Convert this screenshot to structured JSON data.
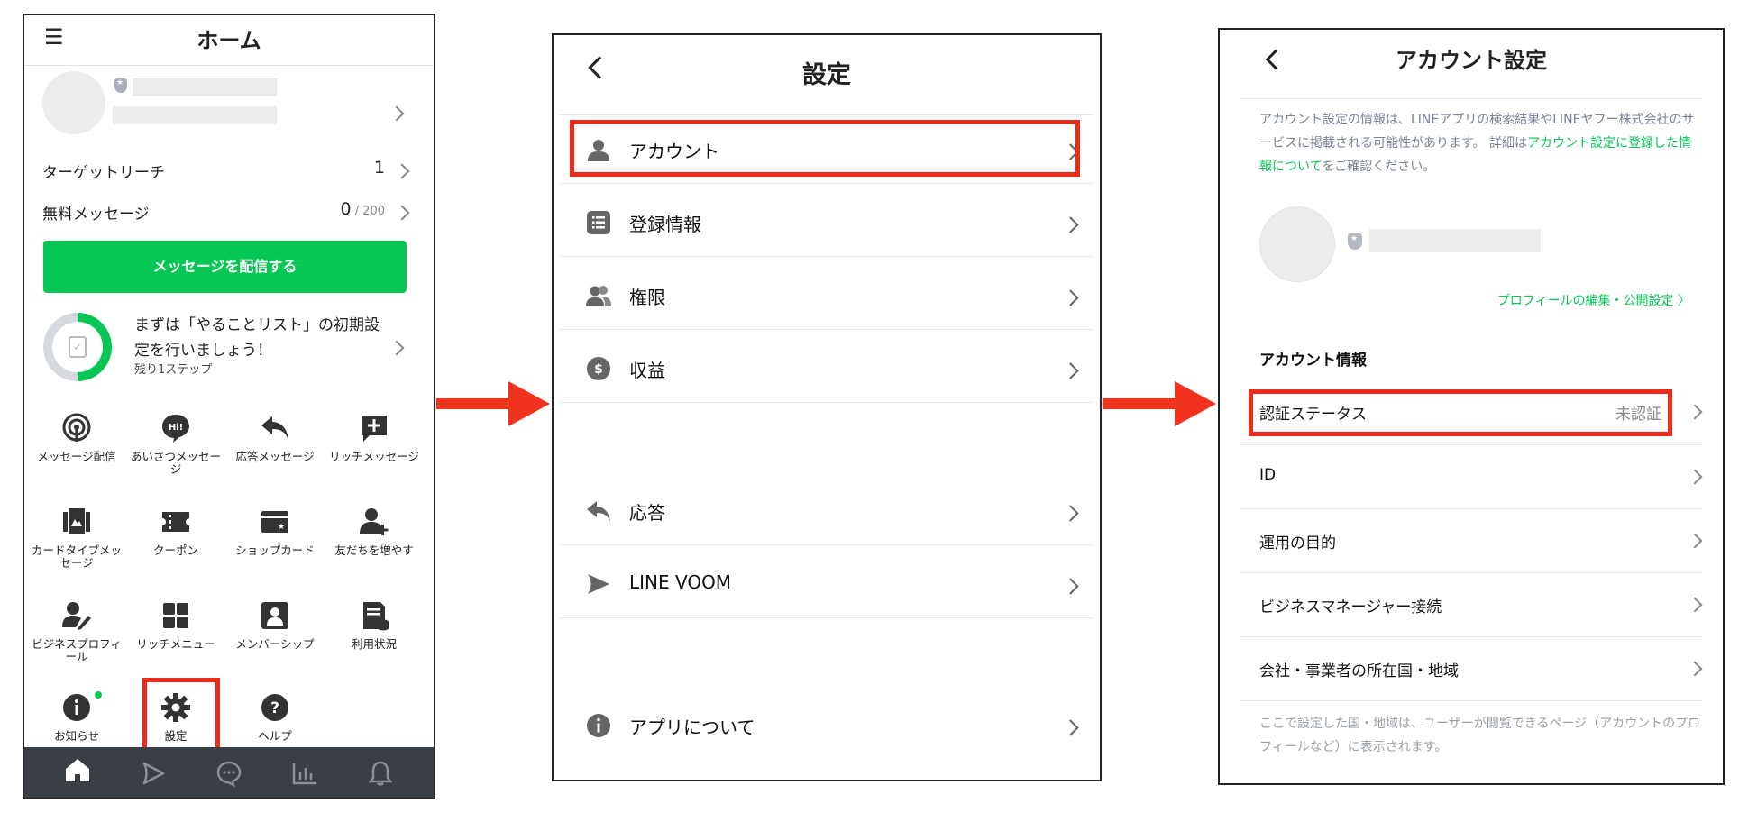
{
  "home": {
    "menu_icon": "hamburger-icon",
    "title": "ホーム",
    "target_reach_label": "ターゲットリーチ",
    "target_reach_value": "1",
    "free_message_label": "無料メッセージ",
    "free_message_value": "0",
    "free_message_total": " / 200",
    "cta_label": "メッセージを配信する",
    "todo_title": "まずは「やることリスト」の初期設定を行いましょう！",
    "todo_sub": "残り1ステップ",
    "todo_progress": 0.5,
    "grid": [
      {
        "label": "メッセージ配信",
        "icon": "broadcast-icon"
      },
      {
        "label": "あいさつメッセージ",
        "icon": "greeting-icon"
      },
      {
        "label": "応答メッセージ",
        "icon": "reply-icon"
      },
      {
        "label": "リッチメッセージ",
        "icon": "rich-message-icon"
      },
      {
        "label": "カードタイプメッセージ",
        "icon": "card-type-icon"
      },
      {
        "label": "クーポン",
        "icon": "coupon-icon"
      },
      {
        "label": "ショップカード",
        "icon": "shop-card-icon"
      },
      {
        "label": "友だちを増やす",
        "icon": "add-friend-icon"
      },
      {
        "label": "ビジネスプロフィール",
        "icon": "business-profile-icon"
      },
      {
        "label": "リッチメニュー",
        "icon": "rich-menu-icon"
      },
      {
        "label": "メンバーシップ",
        "icon": "membership-icon"
      },
      {
        "label": "利用状況",
        "icon": "usage-icon"
      },
      {
        "label": "お知らせ",
        "icon": "info-icon"
      },
      {
        "label": "設定",
        "icon": "gear-icon"
      },
      {
        "label": "ヘルプ",
        "icon": "help-icon"
      }
    ],
    "tabs": [
      "home-icon",
      "voom-icon",
      "chat-icon",
      "insight-icon",
      "bell-icon"
    ]
  },
  "settings": {
    "title": "設定",
    "items": [
      {
        "label": "アカウント",
        "icon": "person-icon"
      },
      {
        "label": "登録情報",
        "icon": "list-icon"
      },
      {
        "label": "権限",
        "icon": "users-icon"
      },
      {
        "label": "収益",
        "icon": "dollar-icon"
      },
      {
        "label": "応答",
        "icon": "reply-icon"
      },
      {
        "label": "LINE VOOM",
        "icon": "voom-icon"
      },
      {
        "label": "アプリについて",
        "icon": "info-icon"
      }
    ]
  },
  "account": {
    "title": "アカウント設定",
    "notice_text": "アカウント設定の情報は、LINEアプリの検索結果やLINEヤフー株式会社のサービスに掲載される可能性があります。 詳細は",
    "notice_link": "アカウント設定に登録した情報について",
    "notice_tail": "をご確認ください。",
    "profile_link": "プロフィールの編集・公開設定",
    "section_title": "アカウント情報",
    "rows": [
      {
        "label": "認証ステータス",
        "value": "未認証"
      },
      {
        "label": "ID",
        "value": ""
      },
      {
        "label": "運用の目的",
        "value": ""
      },
      {
        "label": "ビジネスマネージャー接続",
        "value": ""
      },
      {
        "label": "会社・事業者の所在国・地域",
        "value": ""
      }
    ],
    "footer": "ここで設定した国・地域は、ユーザーが閲覧できるページ（アカウントのプロフィールなど）に表示されます。"
  },
  "colors": {
    "accent_green": "#06c755",
    "highlight_red": "#ee2a1a",
    "tabbar": "#3a3f45"
  }
}
